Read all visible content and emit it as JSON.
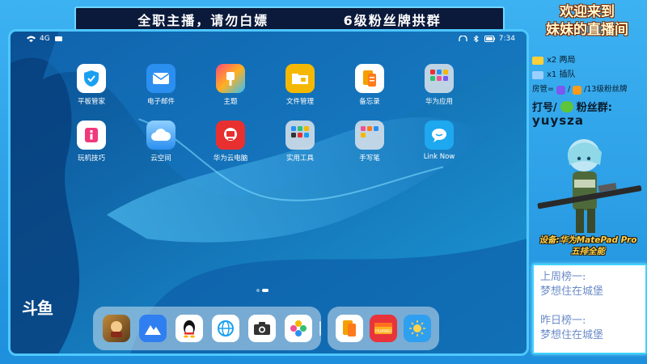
{
  "banner": {
    "left_text": "全职主播，请勿白嫖",
    "right_text": "6级粉丝牌拱群"
  },
  "status_bar": {
    "network": "4G",
    "time": "7:34"
  },
  "apps": [
    {
      "label": "平板管家",
      "icon": "shield-icon",
      "color": "#ffffff"
    },
    {
      "label": "电子邮件",
      "icon": "mail-icon",
      "color": "#2b8ff0"
    },
    {
      "label": "主题",
      "icon": "brush-icon",
      "color": "#f04a8a"
    },
    {
      "label": "文件管理",
      "icon": "folder-icon",
      "color": "#f5b800"
    },
    {
      "label": "备忘录",
      "icon": "memo-icon",
      "color": "#ffffff"
    },
    {
      "label": "华为应用",
      "icon": "app-folder-icon",
      "color": "#cfd8e0"
    },
    {
      "label": "玩机技巧",
      "icon": "tips-icon",
      "color": "#f0387a"
    },
    {
      "label": "云空间",
      "icon": "cloud-icon",
      "color": "#4aa8f0"
    },
    {
      "label": "华为云电脑",
      "icon": "cloud-pc-icon",
      "color": "#e83030"
    },
    {
      "label": "实用工具",
      "icon": "tools-folder-icon",
      "color": "#cfd8e0"
    },
    {
      "label": "手写笔",
      "icon": "stylus-folder-icon",
      "color": "#cfd8e0"
    },
    {
      "label": "Link Now",
      "icon": "chat-bubble-icon",
      "color": "#1ea8f0"
    }
  ],
  "dock": {
    "main": [
      {
        "icon": "game-icon",
        "color": "#a86a2a"
      },
      {
        "icon": "mountain-icon",
        "color": "#2f7ff0"
      },
      {
        "icon": "qq-penguin-icon",
        "color": "#ffffff"
      },
      {
        "icon": "browser-icon",
        "color": "#ffffff"
      },
      {
        "icon": "camera-icon",
        "color": "#ffffff"
      },
      {
        "icon": "gallery-icon",
        "color": "#ffffff"
      }
    ],
    "recent": [
      {
        "icon": "memo-icon",
        "color": "#ffffff"
      },
      {
        "icon": "huawei-store-icon",
        "color": "#e8333a"
      },
      {
        "icon": "weather-icon",
        "color": "#2f9ff0"
      }
    ]
  },
  "watermark": "斗鱼",
  "side_panel": {
    "title_line1": "欢迎来到",
    "title_line2": "妹妹的直播间",
    "gift_rows": [
      {
        "text": "x2 两局"
      },
      {
        "text": "x1 插队"
      }
    ],
    "admin_prefix": "房管=",
    "admin_suffix": "/13级粉丝牌",
    "fans_prefix": "打号/",
    "fans_suffix": "粉丝群:",
    "fans_id": "yuysza",
    "device_line1": "设备:华为MatePad Pro",
    "device_line2": "五排全能",
    "rank_last_week_label": "上周榜一:",
    "rank_last_week_name": "梦想住在城堡",
    "rank_yesterday_label": "昨日榜一:",
    "rank_yesterday_name": "梦想住在城堡"
  }
}
